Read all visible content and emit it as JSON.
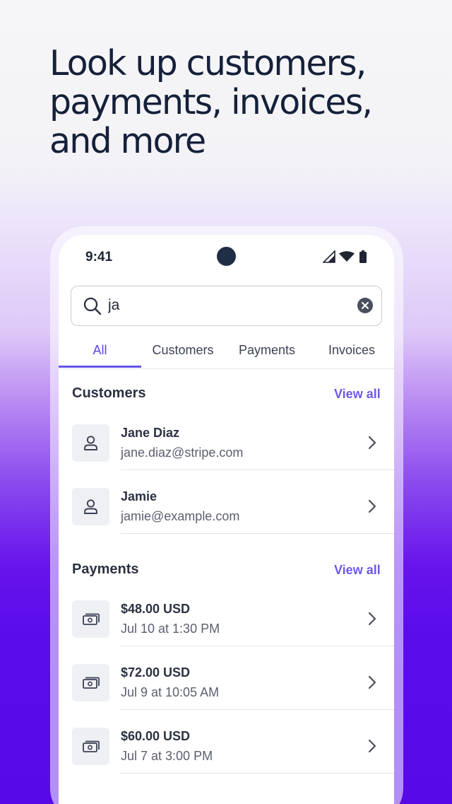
{
  "headline": {
    "line1": "Look up customers,",
    "line2": "payments, invoices,",
    "line3": "and more"
  },
  "status_bar": {
    "time": "9:41",
    "icons": [
      "signal-icon",
      "wifi-icon",
      "battery-icon"
    ]
  },
  "search": {
    "value": "ja",
    "icon": "search-icon",
    "clear_icon": "clear-icon"
  },
  "tabs": [
    {
      "label": "All",
      "active": true
    },
    {
      "label": "Customers",
      "active": false
    },
    {
      "label": "Payments",
      "active": false
    },
    {
      "label": "Invoices",
      "active": false
    }
  ],
  "customers": {
    "title": "Customers",
    "view_all": "View all",
    "items": [
      {
        "name": "Jane Diaz",
        "email": "jane.diaz@stripe.com",
        "icon": "person-icon"
      },
      {
        "name": "Jamie",
        "email": "jamie@example.com",
        "icon": "person-icon"
      }
    ]
  },
  "payments": {
    "title": "Payments",
    "view_all": "View all",
    "items": [
      {
        "amount": "$48.00 USD",
        "date": "Jul 10 at 1:30 PM",
        "icon": "money-icon"
      },
      {
        "amount": "$72.00 USD",
        "date": "Jul 9 at 10:05 AM",
        "icon": "money-icon"
      },
      {
        "amount": "$60.00 USD",
        "date": "Jul 7 at 3:00 PM",
        "icon": "money-icon"
      }
    ]
  },
  "colors": {
    "accent": "#5a45e6",
    "headline": "#15203a",
    "background_bottom": "#5709e8"
  }
}
